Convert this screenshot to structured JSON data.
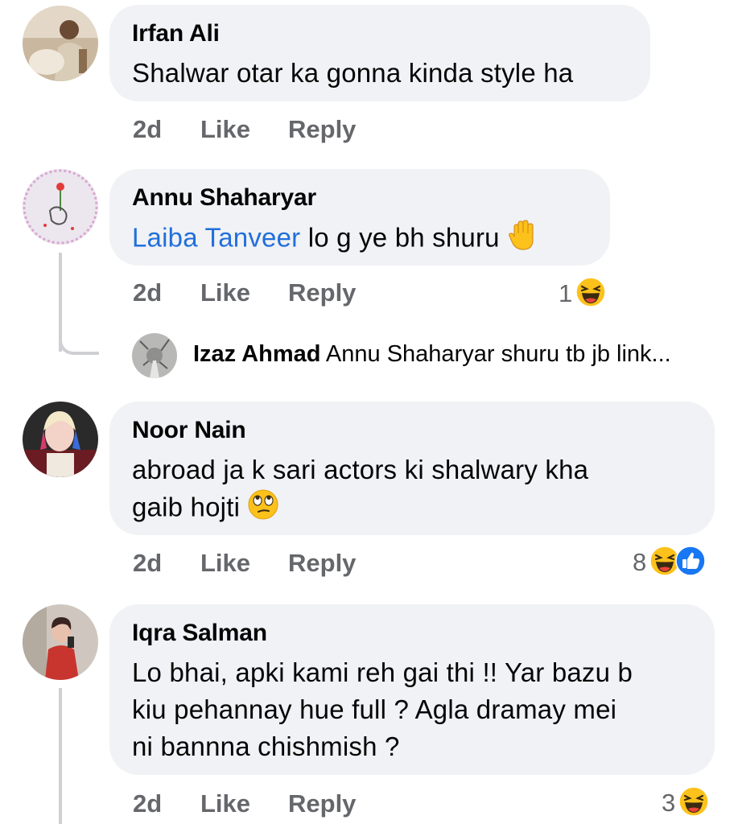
{
  "colors": {
    "bubble": "#f0f2f5",
    "meta": "#65676b",
    "mention": "#216fdb",
    "line": "#ced0d4"
  },
  "comments": [
    {
      "author": "Irfan Ali",
      "text": "Shalwar otar ka gonna kinda style ha",
      "time": "2d",
      "like": "Like",
      "reply": "Reply"
    },
    {
      "author": "Annu Shaharyar",
      "mention": "Laiba Tanveer",
      "text": "lo g ye bh shuru",
      "emoji": "raised-hand",
      "time": "2d",
      "like": "Like",
      "reply": "Reply",
      "reaction_count": "1",
      "reactions": [
        "haha"
      ]
    },
    {
      "author": "Noor Nain",
      "text_line1": "abroad ja k sari actors ki shalwary kha",
      "text_line2": "gaib hojti",
      "emoji": "eye-roll-face",
      "time": "2d",
      "like": "Like",
      "reply": "Reply",
      "reaction_count": "8",
      "reactions": [
        "haha",
        "like"
      ]
    },
    {
      "author": "Iqra Salman",
      "text_line1": "Lo bhai, apki kami reh gai thi !! Yar bazu b",
      "text_line2": "kiu pehannay hue full ? Agla dramay mei",
      "text_line3": "ni bannna chishmish ?",
      "time": "2d",
      "like": "Like",
      "reply": "Reply",
      "reaction_count": "3",
      "reactions": [
        "haha"
      ]
    }
  ],
  "reply_preview": {
    "author": "Izaz Ahmad",
    "text": "Annu Shaharyar shuru tb jb link..."
  }
}
